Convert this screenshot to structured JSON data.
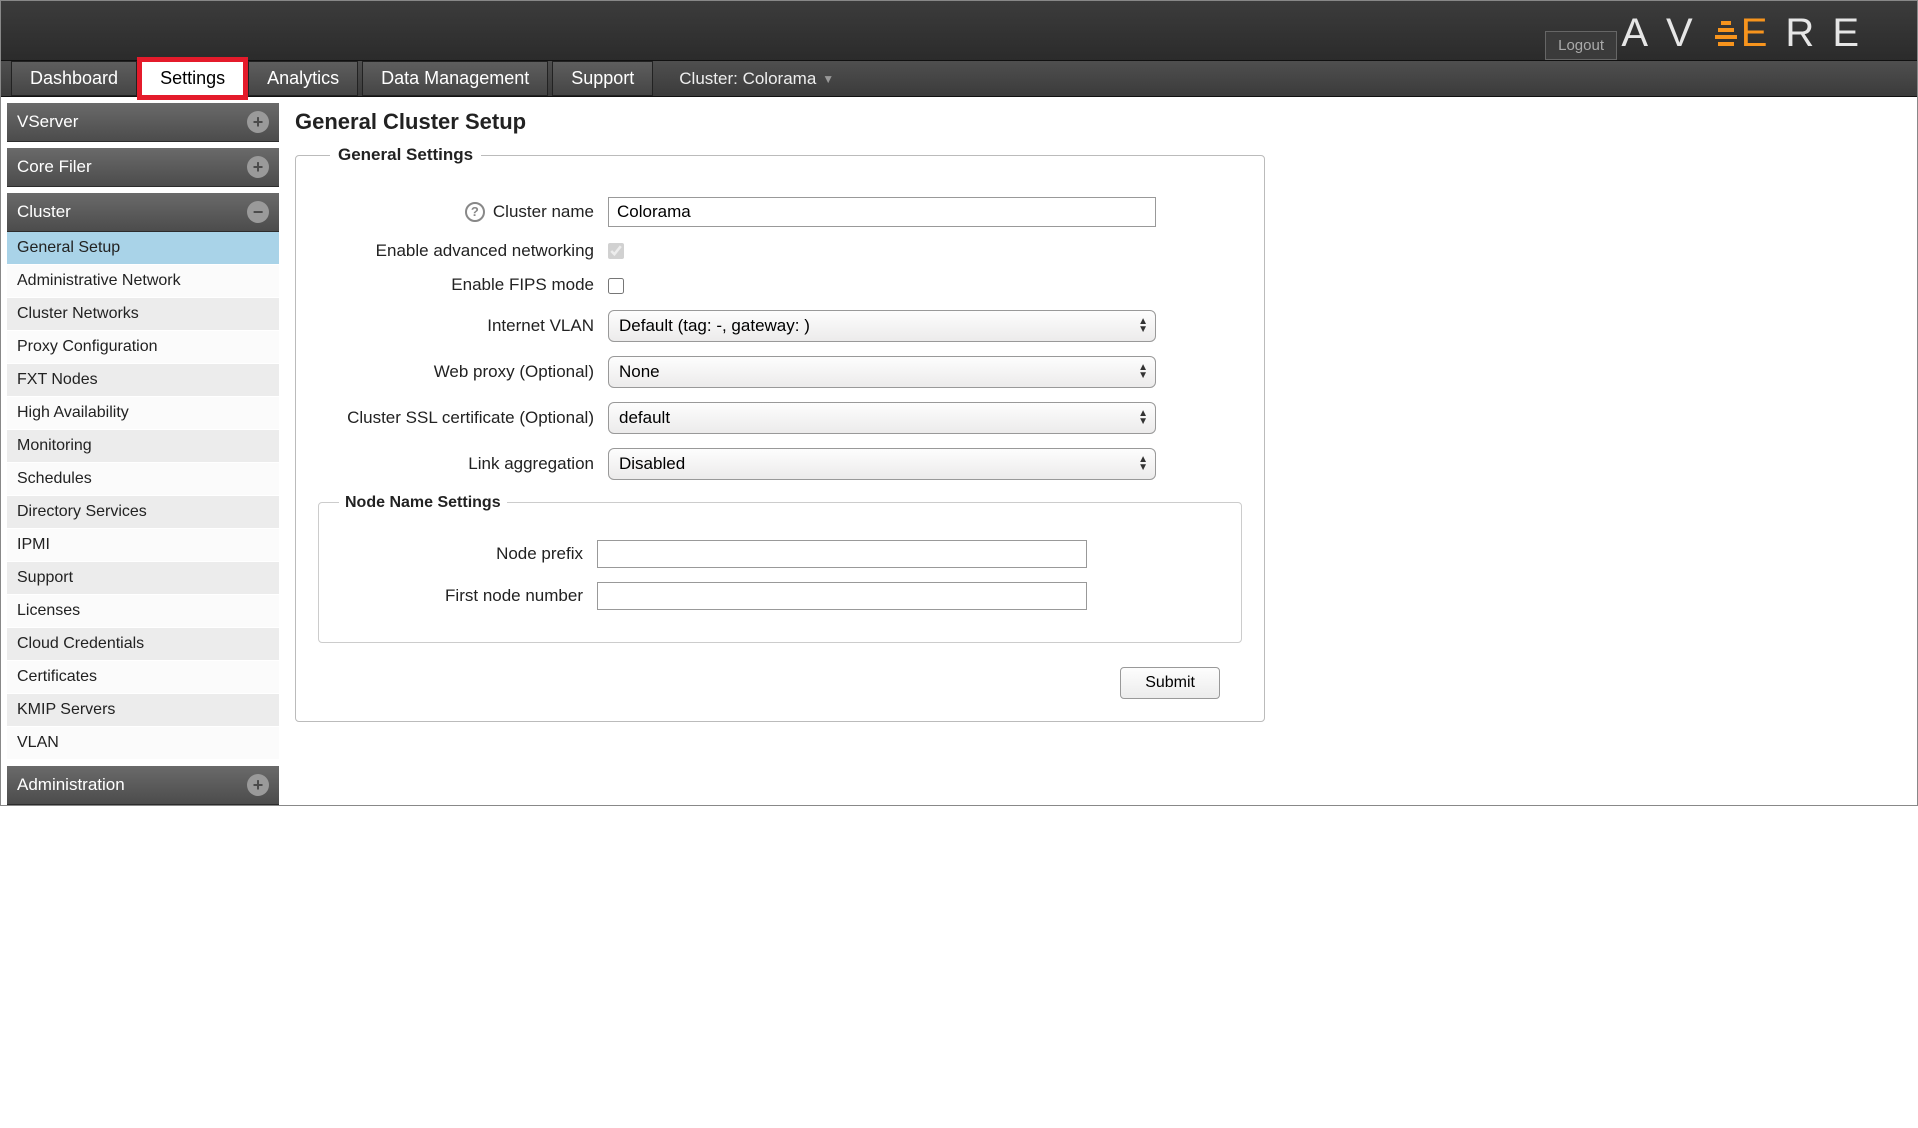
{
  "header": {
    "logout": "Logout",
    "brand_letters": [
      "A",
      "V",
      "E",
      "R",
      "E"
    ]
  },
  "tabs": {
    "dashboard": "Dashboard",
    "settings": "Settings",
    "analytics": "Analytics",
    "data_mgmt": "Data Management",
    "support": "Support",
    "cluster_label": "Cluster: Colorama"
  },
  "sidebar": {
    "vserver": "VServer",
    "corefiler": "Core Filer",
    "cluster": "Cluster",
    "administration": "Administration",
    "cluster_items": [
      "General Setup",
      "Administrative Network",
      "Cluster Networks",
      "Proxy Configuration",
      "FXT Nodes",
      "High Availability",
      "Monitoring",
      "Schedules",
      "Directory Services",
      "IPMI",
      "Support",
      "Licenses",
      "Cloud Credentials",
      "Certificates",
      "KMIP Servers",
      "VLAN"
    ]
  },
  "page": {
    "title": "General Cluster Setup",
    "general_legend": "General Settings",
    "node_legend": "Node Name Settings",
    "labels": {
      "cluster_name": "Cluster name",
      "adv_net": "Enable advanced networking",
      "fips": "Enable FIPS mode",
      "inet_vlan": "Internet VLAN",
      "web_proxy": "Web proxy (Optional)",
      "ssl_cert": "Cluster SSL certificate (Optional)",
      "link_agg": "Link aggregation",
      "node_prefix": "Node prefix",
      "first_node": "First node number"
    },
    "values": {
      "cluster_name": "Colorama",
      "adv_net_checked": true,
      "fips_checked": false,
      "inet_vlan": "Default (tag: -, gateway:              )",
      "web_proxy": "None",
      "ssl_cert": "default",
      "link_agg": "Disabled",
      "node_prefix": "",
      "first_node": ""
    },
    "submit": "Submit"
  }
}
